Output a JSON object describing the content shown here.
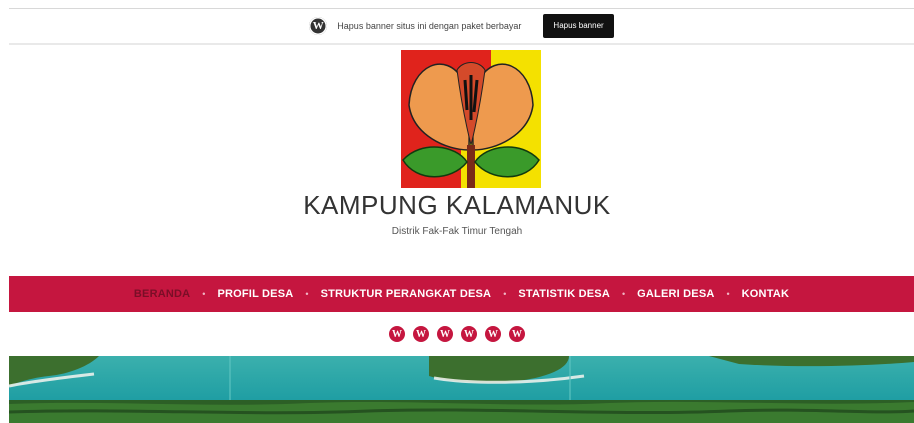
{
  "banner": {
    "icon": "wordpress-icon",
    "text": "Hapus banner situs ini dengan paket berbayar",
    "button_label": "Hapus banner"
  },
  "site": {
    "title": "KAMPUNG KALAMANUK",
    "tagline": "Distrik Fak-Fak Timur Tengah"
  },
  "nav": {
    "items": [
      {
        "label": "BERANDA",
        "active": true
      },
      {
        "label": "PROFIL DESA"
      },
      {
        "label": "STRUKTUR PERANGKAT DESA"
      },
      {
        "label": "STATISTIK DESA"
      },
      {
        "label": "GALERI DESA"
      },
      {
        "label": "KONTAK"
      }
    ],
    "separator": "•"
  },
  "social": {
    "icons": [
      "wordpress-icon",
      "wordpress-icon",
      "wordpress-icon",
      "wordpress-icon",
      "wordpress-icon",
      "wordpress-icon"
    ]
  },
  "colors": {
    "accent": "#c5163f",
    "banner_button": "#111111"
  }
}
